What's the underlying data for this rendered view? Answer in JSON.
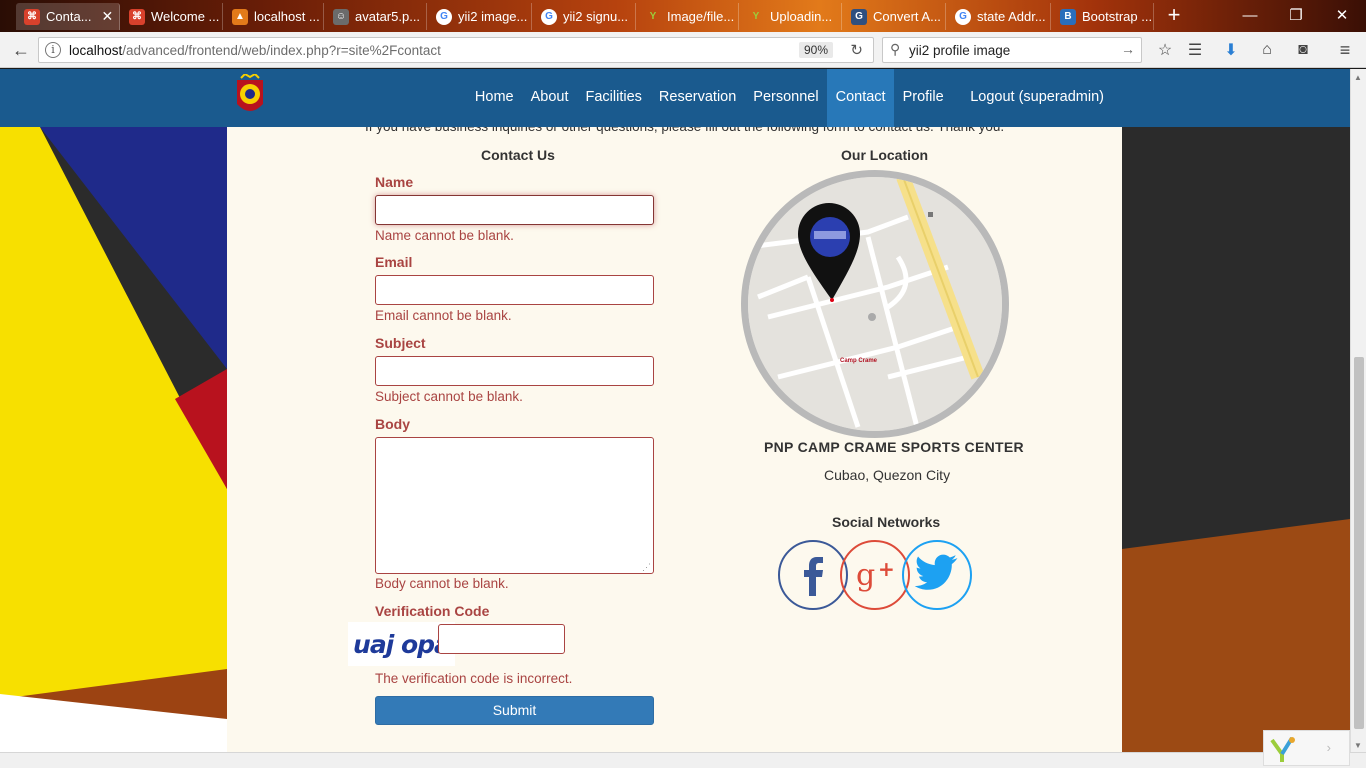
{
  "browser": {
    "tabs": [
      {
        "label": "Conta...",
        "active": true
      },
      {
        "label": "Welcome ..."
      },
      {
        "label": "localhost ..."
      },
      {
        "label": "avatar5.p..."
      },
      {
        "label": "yii2 image..."
      },
      {
        "label": "yii2 signu..."
      },
      {
        "label": "Image/file..."
      },
      {
        "label": "Uploadin..."
      },
      {
        "label": "Convert A..."
      },
      {
        "label": "state Addr..."
      },
      {
        "label": "Bootstrap ..."
      }
    ],
    "url_host": "localhost",
    "url_path": "/advanced/frontend/web/index.php?r=site%2Fcontact",
    "zoom": "90%",
    "search_value": "yii2 profile image"
  },
  "site": {
    "menu": [
      {
        "label": "Home"
      },
      {
        "label": "About"
      },
      {
        "label": "Facilities"
      },
      {
        "label": "Reservation"
      },
      {
        "label": "Personnel"
      },
      {
        "label": "Contact",
        "active": true
      },
      {
        "label": "Profile"
      },
      {
        "label": "Logout (superadmin)"
      }
    ]
  },
  "contact": {
    "intro": "If you have business inquiries or other questions, please fill out the following form to contact us. Thank you.",
    "form_title": "Contact Us",
    "fields": {
      "name": {
        "label": "Name",
        "error": "Name cannot be blank."
      },
      "email": {
        "label": "Email",
        "error": "Email cannot be blank."
      },
      "subject": {
        "label": "Subject",
        "error": "Subject cannot be blank."
      },
      "body": {
        "label": "Body",
        "error": "Body cannot be blank."
      },
      "verify": {
        "label": "Verification Code",
        "error": "The verification code is incorrect.",
        "captcha_text": "uaj opa"
      }
    },
    "submit_label": "Submit"
  },
  "location": {
    "title": "Our Location",
    "map_label": "Camp Crame",
    "place": "PNP CAMP CRAME SPORTS CENTER",
    "city": "Cubao, Quezon City",
    "social_title": "Social Networks",
    "social": [
      {
        "name": "facebook-icon",
        "color": "#3b5998"
      },
      {
        "name": "google-plus-icon",
        "color": "#dd4b39"
      },
      {
        "name": "twitter-icon",
        "color": "#1da1f2"
      }
    ]
  },
  "colors": {
    "nav_bg": "#1a5a8e",
    "nav_active": "#2878b8",
    "error": "#a94442",
    "primary_button": "#337ab7"
  }
}
